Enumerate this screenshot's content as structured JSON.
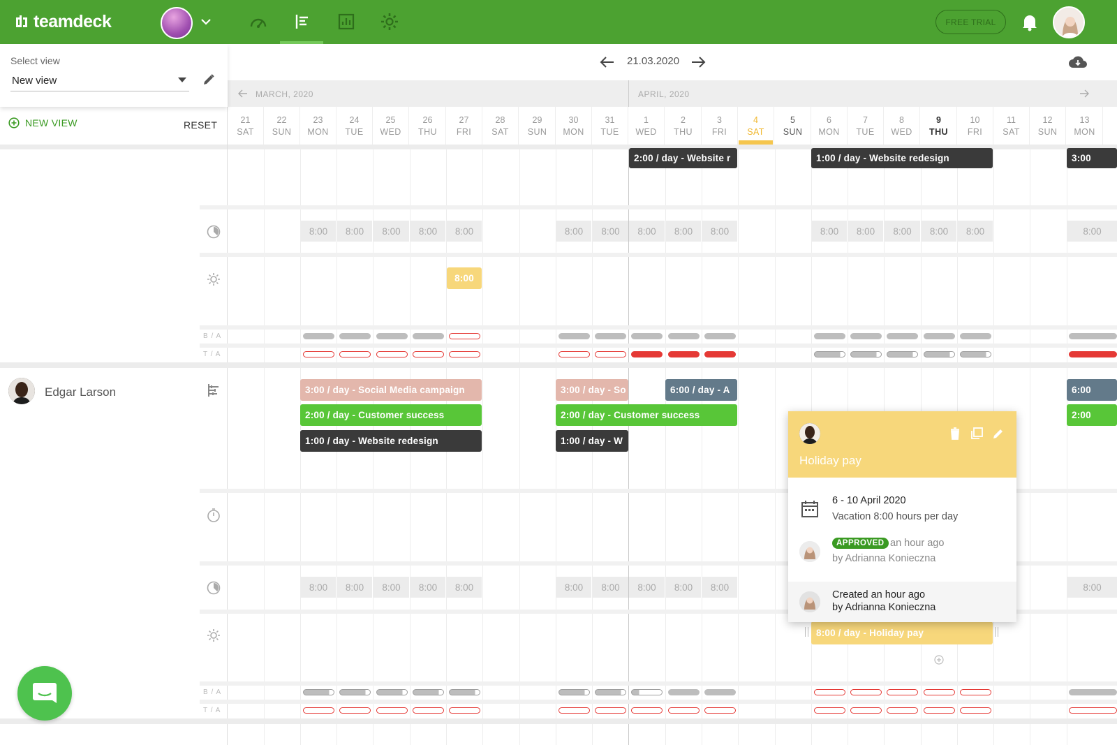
{
  "topbar": {
    "logo": "teamdeck",
    "trial_button": "FREE TRIAL",
    "colors": {
      "brand": "#4ca231",
      "accent": "#74c95a"
    },
    "nav": [
      {
        "icon": "dashboard-icon"
      },
      {
        "icon": "timeline-icon",
        "active": true
      },
      {
        "icon": "reports-icon"
      },
      {
        "icon": "settings-icon"
      }
    ]
  },
  "sidebar": {
    "select_label": "Select view",
    "select_value": "New view",
    "new_view": "NEW VIEW",
    "reset": "RESET"
  },
  "timeline": {
    "current_date": "21.03.2020",
    "months": [
      "MARCH, 2020",
      "APRIL, 2020"
    ],
    "days": [
      {
        "n": "21",
        "w": "SAT"
      },
      {
        "n": "22",
        "w": "SUN"
      },
      {
        "n": "23",
        "w": "MON"
      },
      {
        "n": "24",
        "w": "TUE"
      },
      {
        "n": "25",
        "w": "WED"
      },
      {
        "n": "26",
        "w": "THU"
      },
      {
        "n": "27",
        "w": "FRI"
      },
      {
        "n": "28",
        "w": "SAT"
      },
      {
        "n": "29",
        "w": "SUN"
      },
      {
        "n": "30",
        "w": "MON"
      },
      {
        "n": "31",
        "w": "TUE"
      },
      {
        "n": "1",
        "w": "WED"
      },
      {
        "n": "2",
        "w": "THU"
      },
      {
        "n": "3",
        "w": "FRI"
      },
      {
        "n": "4",
        "w": "SAT",
        "today": true
      },
      {
        "n": "5",
        "w": "SUN"
      },
      {
        "n": "6",
        "w": "MON"
      },
      {
        "n": "7",
        "w": "TUE"
      },
      {
        "n": "8",
        "w": "WED"
      },
      {
        "n": "9",
        "w": "THU",
        "bold": true
      },
      {
        "n": "10",
        "w": "FRI"
      },
      {
        "n": "11",
        "w": "SAT"
      },
      {
        "n": "12",
        "w": "SUN"
      },
      {
        "n": "13",
        "w": "MON"
      }
    ],
    "hours_value": "8:00",
    "row_tags": {
      "ba": "B / A",
      "ta": "T / A"
    }
  },
  "tasks": {
    "top1": "2:00 / day - Website r",
    "top2": "1:00 / day - Website redesign",
    "top3": "3:00",
    "holiday_top": "8:00",
    "edgar_social": "3:00 / day - Social Media campaign",
    "edgar_social_short": "3:00 / day - So",
    "edgar_a": "6:00 / day - A",
    "edgar_a_right": "6:00",
    "edgar_cs": "2:00 / day - Customer success",
    "edgar_cs_right": "2:00",
    "edgar_web": "1:00 / day - Website redesign",
    "edgar_web_short": "1:00 / day - W",
    "holiday_pay": "8:00 / day - Holiday pay"
  },
  "person": {
    "name": "Edgar Larson"
  },
  "popup": {
    "title": "Holiday pay",
    "dates": "6 - 10 April 2020",
    "vacation": "Vacation 8:00 hours per day",
    "status": "APPROVED",
    "status_time": "an hour ago",
    "status_by": "by Adrianna Konieczna",
    "created": "Created an hour ago",
    "created_by": "by Adrianna Konieczna"
  }
}
